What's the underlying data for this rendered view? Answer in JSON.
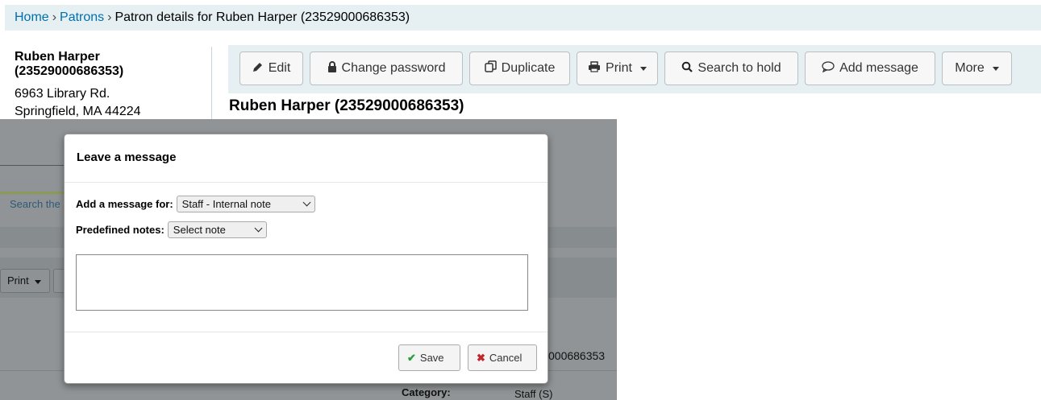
{
  "breadcrumb": {
    "home": "Home",
    "sep": "›",
    "patrons": "Patrons",
    "current": "Patron details for Ruben Harper (23529000686353)"
  },
  "sidebar": {
    "name_line1": "Ruben Harper",
    "name_line2": "(23529000686353)",
    "address_line1": "6963 Library Rd.",
    "address_line2": "Springfield, MA 44224"
  },
  "toolbar": {
    "edit": "Edit",
    "change_password": "Change password",
    "duplicate": "Duplicate",
    "print": "Print",
    "search_to_hold": "Search to hold",
    "add_message": "Add message",
    "more": "More"
  },
  "page_heading": "Ruben Harper (23529000686353)",
  "background": {
    "search_text": "Search the",
    "print_btn": "Print",
    "cardnumber_fragment": "000686353",
    "category_label": "Category:",
    "category_value": "Staff (S)"
  },
  "modal": {
    "title": "Leave a message",
    "message_for_label": "Add a message for:",
    "message_for_value": "Staff - Internal note",
    "predefined_label": "Predefined notes:",
    "predefined_value": "Select note",
    "textarea_value": "",
    "save": "Save",
    "cancel": "Cancel"
  },
  "colors": {
    "link": "#006fb1",
    "toolbar_bg": "#e6f0f2",
    "save_icon": "#2a9d3c",
    "cancel_icon": "#c0262b"
  }
}
